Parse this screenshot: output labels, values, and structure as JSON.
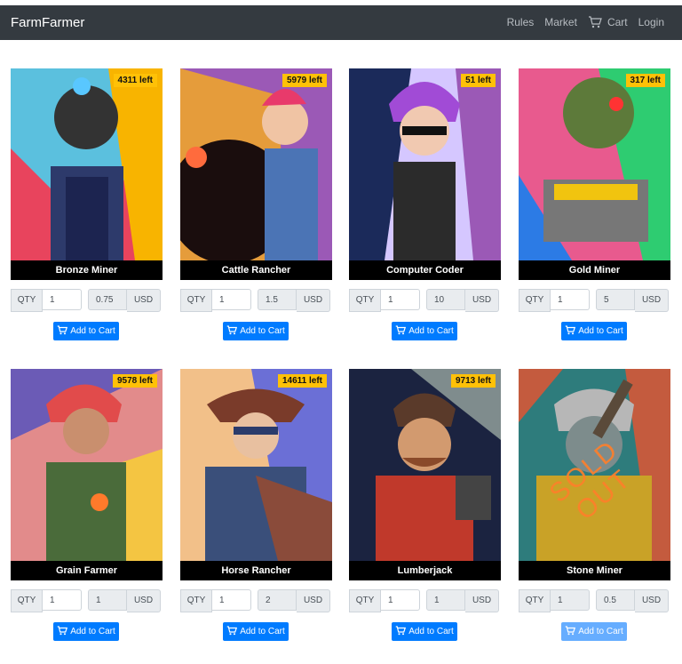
{
  "nav": {
    "brand": "FarmFarmer",
    "links": [
      "Rules",
      "Market",
      "Cart",
      "Login"
    ]
  },
  "labels": {
    "qty": "QTY",
    "usd": "USD",
    "add_to_cart": "Add to Cart",
    "sold_out": "SOLD OUT"
  },
  "products": [
    {
      "name": "Bronze Miner",
      "left": "4311 left",
      "qty": "1",
      "price": "0.75",
      "palette": [
        "#e8445d",
        "#f8b400",
        "#5bc0de"
      ]
    },
    {
      "name": "Cattle Rancher",
      "left": "5979 left",
      "qty": "1",
      "price": "1.5",
      "palette": [
        "#e59c3b",
        "#9b59b6",
        "#2c3e50"
      ]
    },
    {
      "name": "Computer Coder",
      "left": "51 left",
      "qty": "1",
      "price": "10",
      "palette": [
        "#1b2a5a",
        "#d5c7ff",
        "#9b59b6"
      ]
    },
    {
      "name": "Gold Miner",
      "left": "317 left",
      "qty": "1",
      "price": "5",
      "palette": [
        "#e85a8e",
        "#2ecc71",
        "#f1c40f"
      ]
    },
    {
      "name": "Grain Farmer",
      "left": "9578 left",
      "qty": "1",
      "price": "1",
      "palette": [
        "#6b5bb6",
        "#e28b8b",
        "#f4c542"
      ]
    },
    {
      "name": "Horse Rancher",
      "left": "14611 left",
      "qty": "1",
      "price": "2",
      "palette": [
        "#f2c089",
        "#6b6fd6",
        "#3a4f7a"
      ]
    },
    {
      "name": "Lumberjack",
      "left": "9713 left",
      "qty": "1",
      "price": "1",
      "palette": [
        "#c0392b",
        "#1b2340",
        "#7f8c8d"
      ]
    },
    {
      "name": "Stone Miner",
      "left": "",
      "qty": "1",
      "price": "0.5",
      "sold_out": true,
      "palette": [
        "#c45b3e",
        "#2e7c7c",
        "#c9a227"
      ]
    }
  ]
}
